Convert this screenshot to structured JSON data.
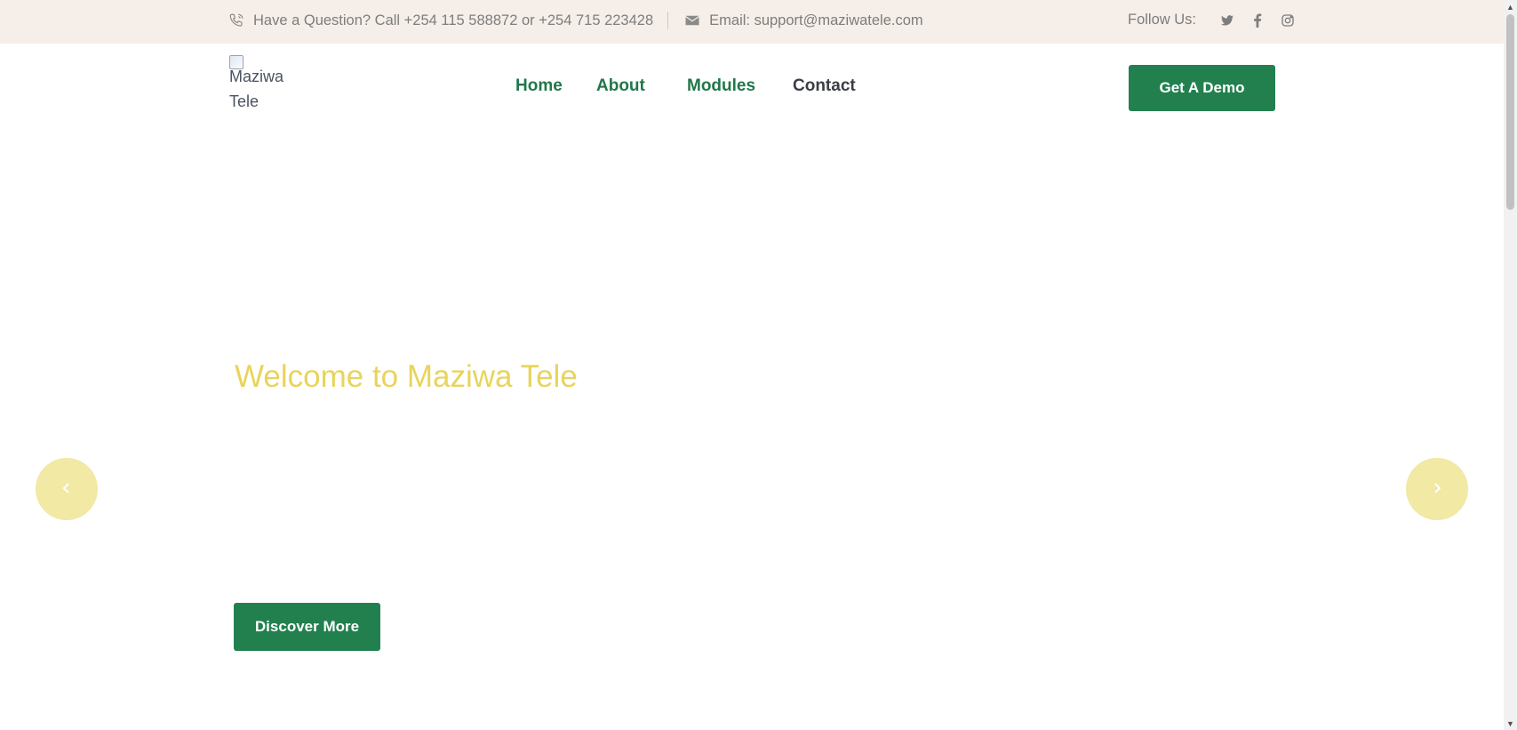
{
  "topbar": {
    "phone_icon": "phone-icon",
    "phone_text": "Have a Question? Call +254 115 588872 or +254 715 223428",
    "mail_icon": "envelope-icon",
    "email_text": "Email: support@maziwatele.com",
    "follow_label": "Follow Us:",
    "socials": [
      "twitter-icon",
      "facebook-icon",
      "instagram-icon"
    ]
  },
  "header": {
    "logo_alt": "Maziwa Tele",
    "nav": {
      "home": "Home",
      "about": "About",
      "modules": "Modules",
      "contact": "Contact"
    },
    "demo_button": "Get A Demo"
  },
  "hero": {
    "title": "Welcome to Maziwa Tele",
    "prev_icon": "chevron-left-icon",
    "next_icon": "chevron-right-icon",
    "discover_button": "Discover More"
  },
  "colors": {
    "brand_green": "#22804f",
    "topbar_bg": "#f6efe9",
    "hero_title": "#e8d45b",
    "arrow_bg": "#f1e9a4"
  }
}
